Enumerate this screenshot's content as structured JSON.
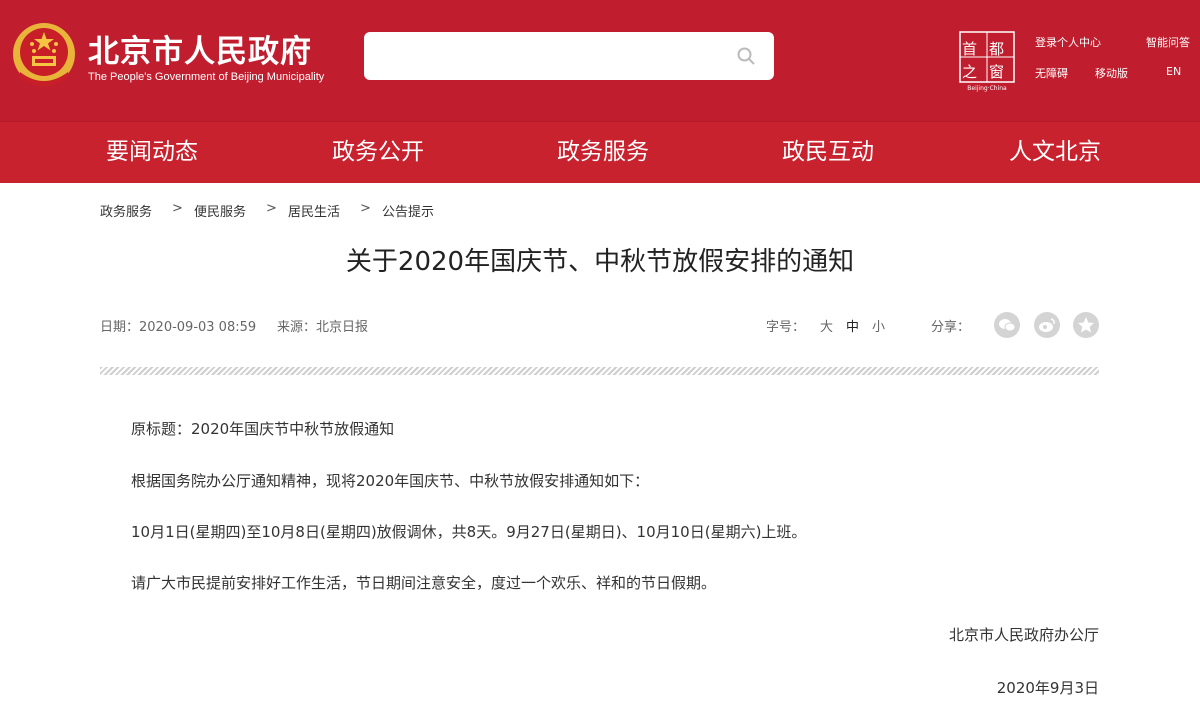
{
  "header": {
    "title": "北京市人民政府",
    "subtitle": "The People's Government of Beijing Municipality",
    "search": {
      "placeholder": "",
      "value": ""
    },
    "capital_logo": {
      "left_top": "首",
      "right_top": "都",
      "left_mid": "之",
      "right_mid": "窗",
      "caption": "Beijing·China"
    },
    "links": {
      "login": "登录个人中心",
      "smart_qa": "智能问答",
      "accessibility": "无障碍",
      "mobile": "移动版",
      "english": "EN"
    },
    "colors": {
      "primary": "#c01e2e"
    }
  },
  "nav": {
    "items": [
      {
        "label": "要闻动态"
      },
      {
        "label": "政务公开"
      },
      {
        "label": "政务服务"
      },
      {
        "label": "政民互动"
      },
      {
        "label": "人文北京"
      }
    ]
  },
  "breadcrumb": {
    "items": [
      "政务服务",
      "便民服务",
      "居民生活",
      "公告提示"
    ],
    "separator": ">"
  },
  "article": {
    "title": "关于2020年国庆节、中秋节放假安排的通知",
    "date": "日期：2020-09-03 08:59",
    "source": "来源：北京日报",
    "font_size_label": "字号：",
    "font_sizes": [
      "大",
      "中",
      "小"
    ],
    "share_label": "分享：",
    "share_icons": [
      "wechat-icon",
      "weibo-icon",
      "favorite-icon"
    ],
    "paragraphs": [
      "原标题：2020年国庆节中秋节放假通知",
      "根据国务院办公厅通知精神，现将2020年国庆节、中秋节放假安排通知如下：",
      "10月1日(星期四)至10月8日(星期四)放假调休，共8天。9月27日(星期日)、10月10日(星期六)上班。",
      "请广大市民提前安排好工作生活，节日期间注意安全，度过一个欢乐、祥和的节日假期。"
    ],
    "signature": "北京市人民政府办公厅",
    "sign_date": "2020年9月3日"
  }
}
